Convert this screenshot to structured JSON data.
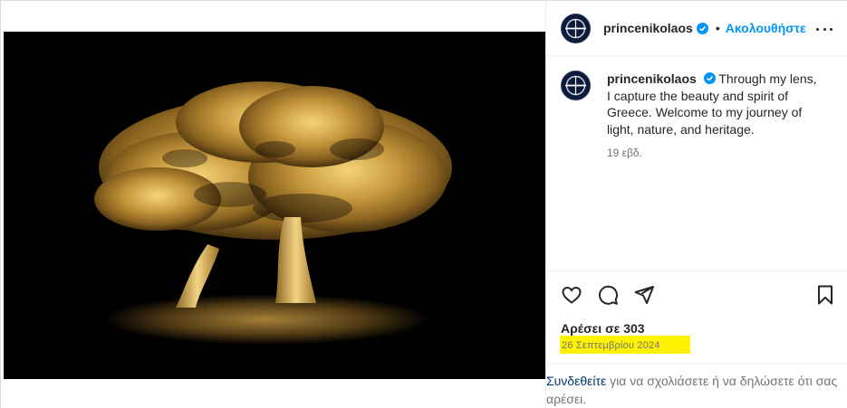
{
  "post": {
    "username": "princenikolaos",
    "follow_label": "Ακολουθήστε",
    "separator": "•",
    "caption": "Through my lens, I capture the beauty and spirit of Greece. Welcome to my journey of light, nature, and heritage.",
    "time_ago": "19 εβδ.",
    "likes": "Αρέσει σε 303",
    "date": "26 Σεπτεμβρίου 2024",
    "login_link": "Συνδεθείτε",
    "login_rest": " για να σχολιάσετε ή να δηλώσετε ότι σας αρέσει."
  },
  "icons": {
    "verified": "verified-badge-icon",
    "more": "more-options-icon",
    "like": "heart-icon",
    "comment": "comment-icon",
    "share": "share-icon",
    "save": "bookmark-icon"
  },
  "colors": {
    "link_blue": "#0095f6",
    "highlight": "#fff200",
    "text": "#262626",
    "secondary": "#737373"
  }
}
